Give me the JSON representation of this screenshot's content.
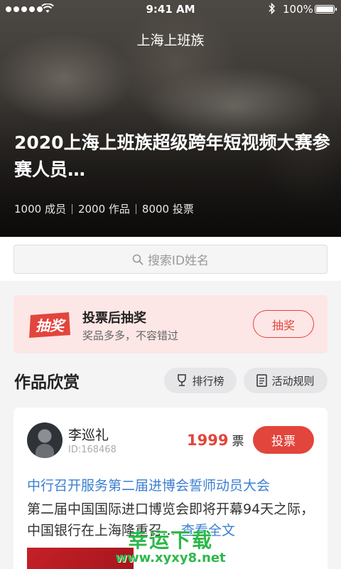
{
  "status_bar": {
    "time": "9:41 AM",
    "battery": "100%"
  },
  "nav": {
    "title": "上海上班族"
  },
  "hero": {
    "title": "2020上海上班族超级跨年短视频大赛参赛人员…",
    "stats": [
      "1000 成员",
      "2000 作品",
      "8000 投票"
    ]
  },
  "search": {
    "placeholder": "搜索ID姓名"
  },
  "lottery": {
    "icon_text": "抽奖",
    "title": "投票后抽奖",
    "subtitle": "奖品多多，不容错过",
    "button": "抽奖"
  },
  "works": {
    "section_title": "作品欣赏",
    "ranking_label": "排行榜",
    "rules_label": "活动规则"
  },
  "card": {
    "user_name": "李巡礼",
    "user_id": "ID:168468",
    "votes": "1999",
    "votes_unit": "票",
    "vote_button": "投票",
    "title": "中行召开服务第二届进博会誓师动员大会",
    "description": "第二届中国国际进口博览会即将开幕94天之际，中国银行在上海隆重召…",
    "more": "查看全文"
  },
  "watermark": {
    "main": "幸运下载",
    "url": "www.xyxy8.net"
  },
  "colors": {
    "accent": "#e2453c",
    "link": "#3b7fd1",
    "lottery_bg": "#fde6e6"
  }
}
